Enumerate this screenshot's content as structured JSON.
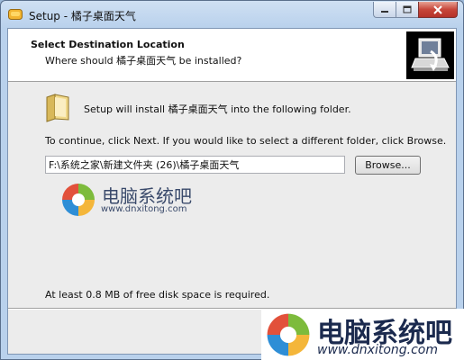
{
  "window": {
    "title": "Setup - 橘子桌面天气"
  },
  "header": {
    "title": "Select Destination Location",
    "subtitle": "Where should 橘子桌面天气 be installed?"
  },
  "body": {
    "install_text": "Setup will install 橘子桌面天气 into the following folder.",
    "continue_text": "To continue, click Next. If you would like to select a different folder, click Browse.",
    "path_value": "F:\\系统之家\\新建文件夹 (26)\\橘子桌面天气",
    "browse_label": "Browse...",
    "space_text": "At least 0.8 MB of free disk space is required."
  },
  "watermark": {
    "name": "电脑系统吧",
    "url": "www.dnxitong.com"
  },
  "icons": {
    "app": "orange-setup-icon",
    "wizard": "computer-install-icon",
    "folder": "folder-icon"
  },
  "colors": {
    "client_bg": "#ececec",
    "header_bg": "#ffffff",
    "close_button": "#c7463a",
    "title_bar": "#b9d1ec"
  }
}
